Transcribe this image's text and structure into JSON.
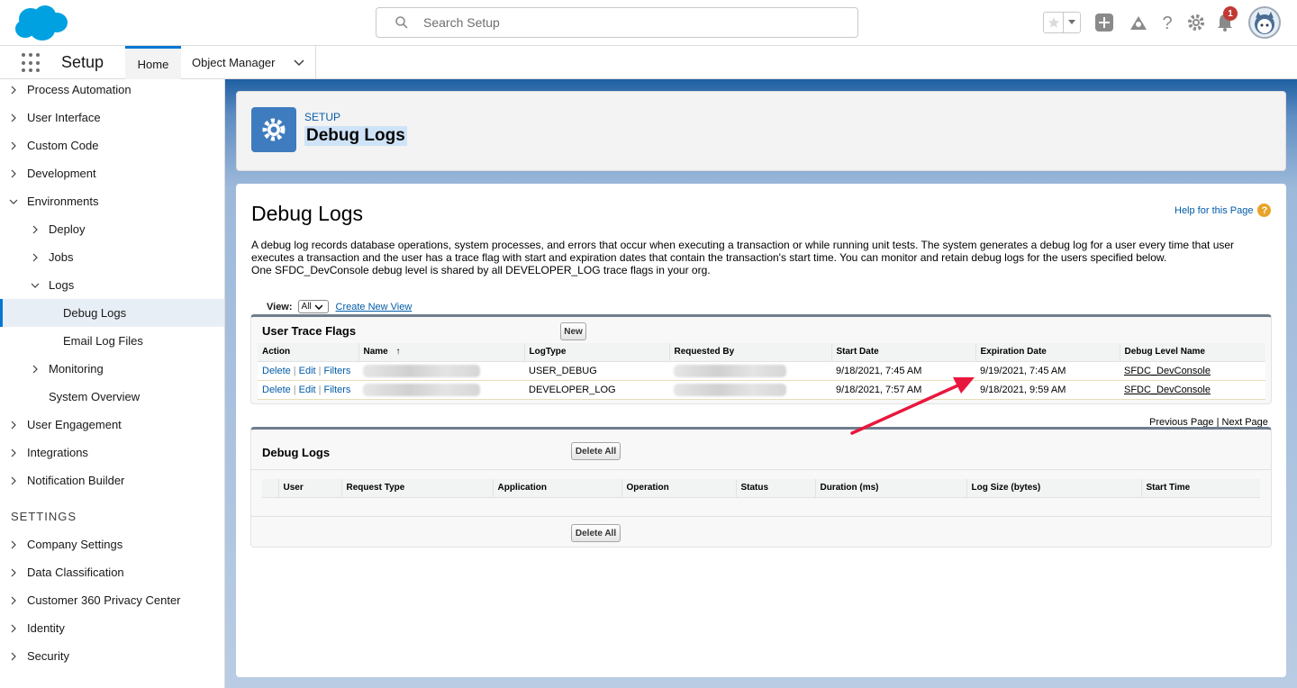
{
  "header": {
    "search_placeholder": "Search Setup",
    "notification_count": "1"
  },
  "nav": {
    "app_name": "Setup",
    "tabs": [
      {
        "label": "Home"
      },
      {
        "label": "Object Manager"
      }
    ]
  },
  "sidebar": {
    "items": [
      {
        "label": "Process Automation"
      },
      {
        "label": "User Interface"
      },
      {
        "label": "Custom Code"
      },
      {
        "label": "Development"
      },
      {
        "label": "Environments"
      },
      {
        "label": "Deploy"
      },
      {
        "label": "Jobs"
      },
      {
        "label": "Logs"
      },
      {
        "label": "Debug Logs"
      },
      {
        "label": "Email Log Files"
      },
      {
        "label": "Monitoring"
      },
      {
        "label": "System Overview"
      },
      {
        "label": "User Engagement"
      },
      {
        "label": "Integrations"
      },
      {
        "label": "Notification Builder"
      }
    ],
    "settings_heading": "SETTINGS",
    "settings_items": [
      {
        "label": "Company Settings"
      },
      {
        "label": "Data Classification"
      },
      {
        "label": "Customer 360 Privacy Center"
      },
      {
        "label": "Identity"
      },
      {
        "label": "Security"
      }
    ]
  },
  "page_header": {
    "kicker": "SETUP",
    "title": "Debug Logs"
  },
  "content": {
    "title": "Debug Logs",
    "help_link": "Help for this Page",
    "description_1": "A debug log records database operations, system processes, and errors that occur when executing a transaction or while running unit tests. The system generates a debug log for a user every time that user executes a transaction and the user has a trace flag with start and expiration dates that contain the transaction's start time. You can monitor and retain debug logs for the users specified below.",
    "description_2": "One SFDC_DevConsole debug level is shared by all DEVELOPER_LOG trace flags in your org.",
    "view_label": "View:",
    "view_value": "All",
    "create_view_link": "Create New View"
  },
  "trace_flags": {
    "title": "User Trace Flags",
    "new_button": "New",
    "columns": [
      "Action",
      "Name",
      "LogType",
      "Requested By",
      "Start Date",
      "Expiration Date",
      "Debug Level Name"
    ],
    "sort_indicator": "↑",
    "actions": {
      "delete": "Delete",
      "edit": "Edit",
      "filters": "Filters",
      "separator": "|"
    },
    "rows": [
      {
        "log_type": "USER_DEBUG",
        "start": "9/18/2021, 7:45 AM",
        "expiration": "9/19/2021, 7:45 AM",
        "level": "SFDC_DevConsole"
      },
      {
        "log_type": "DEVELOPER_LOG",
        "start": "9/18/2021, 7:57 AM",
        "expiration": "9/18/2021, 9:59 AM",
        "level": "SFDC_DevConsole"
      }
    ]
  },
  "pager": {
    "previous": "Previous Page",
    "separator": "|",
    "next": "Next Page"
  },
  "debug_logs": {
    "title": "Debug Logs",
    "delete_all_button": "Delete All",
    "columns": [
      "User",
      "Request Type",
      "Application",
      "Operation",
      "Status",
      "Duration (ms)",
      "Log Size (bytes)",
      "Start Time"
    ]
  },
  "colors": {
    "brand": "#00a1e0",
    "link": "#015ba7",
    "annotation_arrow": "#e8173d"
  }
}
